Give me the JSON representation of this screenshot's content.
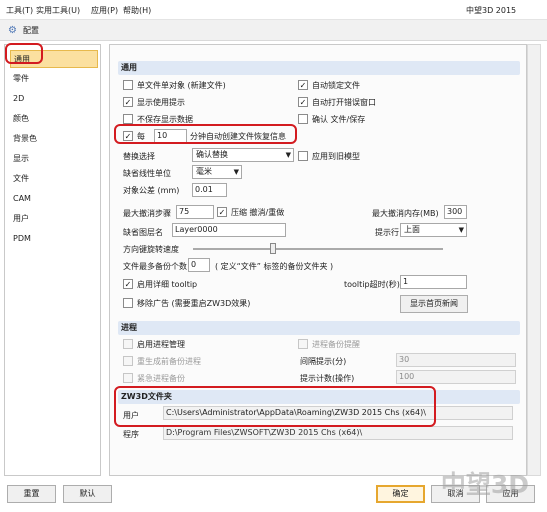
{
  "menu": {
    "tools": "工具(T)",
    "utilities": "实用工具(U)",
    "apps": "应用(P)",
    "help": "帮助(H)",
    "app_title": "中望3D 2015"
  },
  "dialog": {
    "title": "配置",
    "help_icon": "?",
    "pin_icon": "push-pin-icon",
    "close_icon": "×"
  },
  "sidebar": {
    "items": [
      {
        "label": "通用"
      },
      {
        "label": "零件"
      },
      {
        "label": "2D"
      },
      {
        "label": "颜色"
      },
      {
        "label": "背景色"
      },
      {
        "label": "显示"
      },
      {
        "label": "文件"
      },
      {
        "label": "CAM"
      },
      {
        "label": "用户"
      },
      {
        "label": "PDM"
      }
    ]
  },
  "general": {
    "section": "通用",
    "single_file_object": "单文件单对象 (新建文件)",
    "auto_lock_file": "自动锁定文件",
    "show_tips": "显示使用提示",
    "auto_open_error_window": "自动打开错误窗口",
    "no_save_display_data": "不保存显示数据",
    "confirm_file_save": "确认 文件/保存",
    "every_label": "每",
    "every_minutes": "10",
    "recovery_label": "分钟自动创建文件恢复信息",
    "replace_select_label": "替换选择",
    "replace_select_value": "确认替换",
    "apply_to_old_model": "应用到旧模型",
    "default_linear_unit_label": "缺省线性单位",
    "default_linear_unit_value": "毫米",
    "object_tolerance_label": "对象公差 (mm)",
    "object_tolerance_value": "0.01",
    "max_undo_steps_label": "最大撤消步骤",
    "max_undo_steps_value": "75",
    "compress_undo_redo": "压缩 撤消/重做",
    "max_undo_memory_label": "最大撤消内存(MB)",
    "max_undo_memory_value": "300",
    "default_layer_name_label": "缺省图层名",
    "default_layer_name_value": "Layer0000",
    "prompt_line_label": "提示行",
    "prompt_line_value": "上面",
    "direction_key_rotation_speed_label": "方向键旋转速度",
    "max_backup_count_label": "文件最多备份个数",
    "max_backup_count_value": "0",
    "backup_note": "( 定义“文件” 标签的备份文件夹 )",
    "enable_detailed_tooltip": "启用详细 tooltip",
    "tooltip_timeout_label": "tooltip超时(秒)",
    "tooltip_timeout_value": "1",
    "remove_ads": "移除广告 (需要重启ZW3D效果)",
    "show_homepage_news": "显示首页新闻"
  },
  "process": {
    "section": "进程",
    "enable_process_management": "启用进程管理",
    "backup_process_reminder": "进程备份提醒",
    "regen_current_backup_process": "重生成前备份进程",
    "interval_prompt_label": "间隔提示(分)",
    "interval_prompt_value": "30",
    "emergency_process_backup": "紧急进程备份",
    "prompt_count_label": "提示计数(操作)",
    "prompt_count_value": "100"
  },
  "folders": {
    "section": "ZW3D文件夹",
    "user_label": "用户",
    "user_path": "C:\\Users\\Administrator\\AppData\\Roaming\\ZW3D 2015 Chs (x64)\\",
    "program_label": "程序",
    "program_path": "D:\\Program Files\\ZWSOFT\\ZW3D 2015 Chs (x64)\\"
  },
  "buttons": {
    "reset": "重置",
    "default": "默认",
    "ok": "确定",
    "cancel": "取消",
    "apply": "应用"
  },
  "watermark": "中望3D",
  "accent_red": "#d31b20"
}
